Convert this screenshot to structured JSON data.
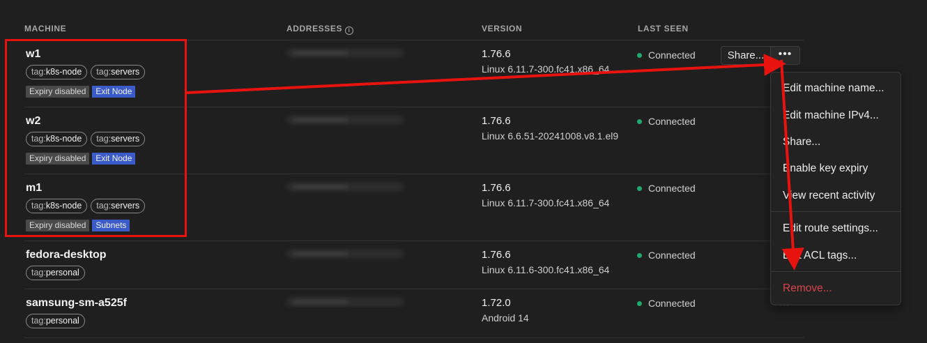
{
  "columns": {
    "machine": "MACHINE",
    "addresses": "ADDRESSES",
    "version": "VERSION",
    "last_seen": "LAST SEEN"
  },
  "machines": [
    {
      "name": "w1",
      "tags": [
        {
          "key": "tag:",
          "value": "k8s-node"
        },
        {
          "key": "tag:",
          "value": "servers"
        }
      ],
      "badges": [
        {
          "label": "Expiry disabled",
          "style": "gray"
        },
        {
          "label": "Exit Node",
          "style": "blue"
        }
      ],
      "version": "1.76.6",
      "os": "Linux 6.11.7-300.fc41.x86_64",
      "status": "Connected"
    },
    {
      "name": "w2",
      "tags": [
        {
          "key": "tag:",
          "value": "k8s-node"
        },
        {
          "key": "tag:",
          "value": "servers"
        }
      ],
      "badges": [
        {
          "label": "Expiry disabled",
          "style": "gray"
        },
        {
          "label": "Exit Node",
          "style": "blue"
        }
      ],
      "version": "1.76.6",
      "os": "Linux 6.6.51-20241008.v8.1.el9",
      "status": "Connected"
    },
    {
      "name": "m1",
      "tags": [
        {
          "key": "tag:",
          "value": "k8s-node"
        },
        {
          "key": "tag:",
          "value": "servers"
        }
      ],
      "badges": [
        {
          "label": "Expiry disabled",
          "style": "gray"
        },
        {
          "label": "Subnets",
          "style": "blue"
        }
      ],
      "version": "1.76.6",
      "os": "Linux 6.11.7-300.fc41.x86_64",
      "status": "Connected"
    },
    {
      "name": "fedora-desktop",
      "tags": [
        {
          "key": "tag:",
          "value": "personal"
        }
      ],
      "badges": [],
      "version": "1.76.6",
      "os": "Linux 6.11.6-300.fc41.x86_64",
      "status": "Connected"
    },
    {
      "name": "samsung-sm-a525f",
      "tags": [
        {
          "key": "tag:",
          "value": "personal"
        }
      ],
      "badges": [],
      "version": "1.72.0",
      "os": "Android 14",
      "status": "Connected"
    }
  ],
  "row_actions": {
    "share_label": "Share...",
    "more_label": "•••"
  },
  "context_menu": {
    "group1": [
      "Edit machine name...",
      "Edit machine IPv4...",
      "Share...",
      "Enable key expiry",
      "View recent activity"
    ],
    "group2": [
      "Edit route settings...",
      "Edit ACL tags..."
    ],
    "group3": [
      "Remove..."
    ]
  },
  "colors": {
    "background": "#1f1f1f",
    "connected_dot": "#1fa870",
    "badge_blue": "#3b5bc9",
    "badge_gray": "#4a4a4a",
    "danger": "#d9454d",
    "annotation_red": "#e8130f"
  },
  "icons": {
    "addresses_info": "info-icon",
    "status": "status-dot-icon",
    "more": "ellipsis-icon"
  }
}
